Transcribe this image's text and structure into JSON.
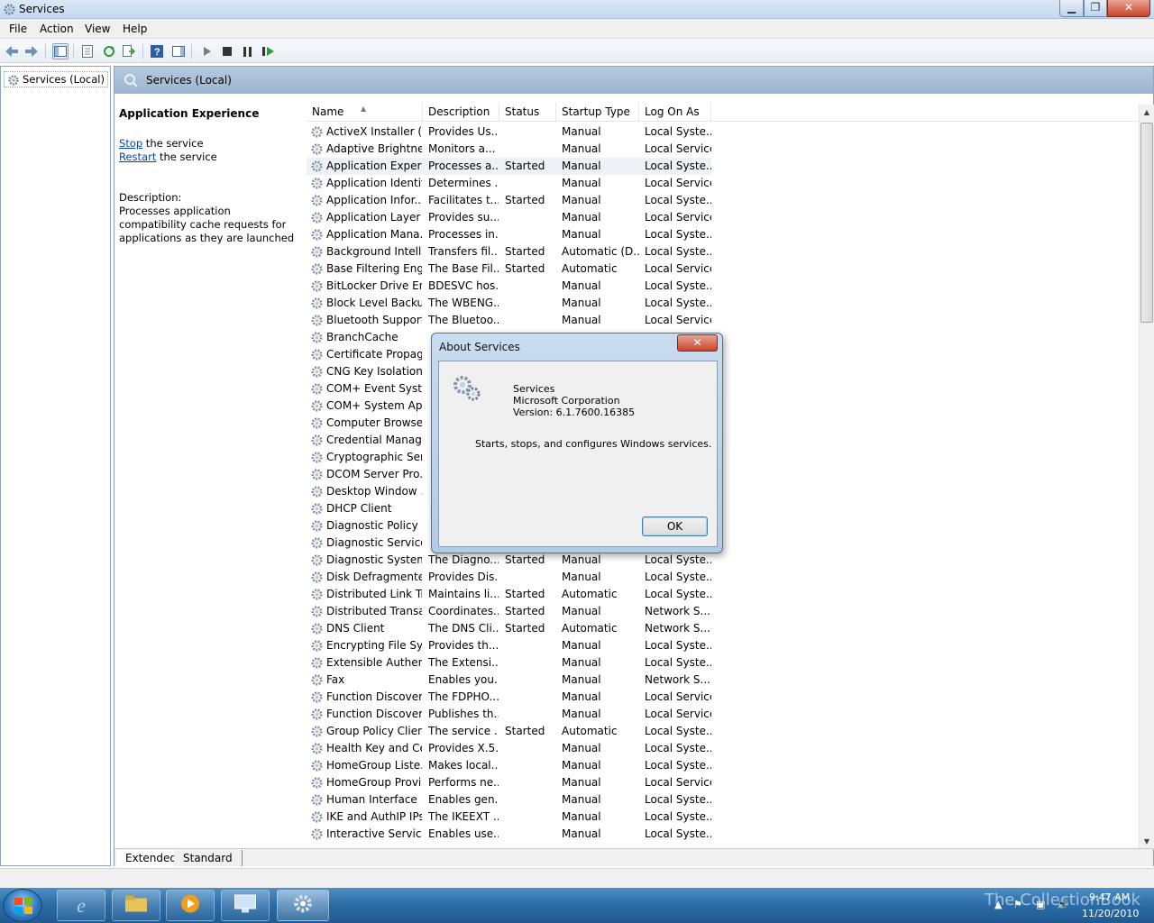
{
  "window": {
    "title": "Services",
    "minimize": "▁",
    "maximize": "❐",
    "close": "✕"
  },
  "menu": [
    "File",
    "Action",
    "View",
    "Help"
  ],
  "tree": {
    "item": "Services (Local)"
  },
  "panel": {
    "header": "Services (Local)",
    "selected_name": "Application Experience",
    "stop_link": "Stop",
    "stop_suffix": " the service",
    "restart_link": "Restart",
    "restart_suffix": " the service",
    "description_label": "Description:",
    "description": "Processes application compatibility cache requests for applications as they are launched"
  },
  "columns": [
    "Name",
    "Description",
    "Status",
    "Startup Type",
    "Log On As"
  ],
  "services": [
    {
      "name": "ActiveX Installer (...",
      "desc": "Provides Us...",
      "status": "",
      "startup": "Manual",
      "logon": "Local Syste..."
    },
    {
      "name": "Adaptive Brightness",
      "desc": "Monitors a...",
      "status": "",
      "startup": "Manual",
      "logon": "Local Service"
    },
    {
      "name": "Application Experi...",
      "desc": "Processes a...",
      "status": "Started",
      "startup": "Manual",
      "logon": "Local Syste..."
    },
    {
      "name": "Application Identity",
      "desc": "Determines ...",
      "status": "",
      "startup": "Manual",
      "logon": "Local Service"
    },
    {
      "name": "Application Infor...",
      "desc": "Facilitates t...",
      "status": "Started",
      "startup": "Manual",
      "logon": "Local Syste..."
    },
    {
      "name": "Application Layer ...",
      "desc": "Provides su...",
      "status": "",
      "startup": "Manual",
      "logon": "Local Service"
    },
    {
      "name": "Application Mana...",
      "desc": "Processes in...",
      "status": "",
      "startup": "Manual",
      "logon": "Local Syste..."
    },
    {
      "name": "Background Intelli...",
      "desc": "Transfers fil...",
      "status": "Started",
      "startup": "Automatic (D...",
      "logon": "Local Syste..."
    },
    {
      "name": "Base Filtering Engi...",
      "desc": "The Base Fil...",
      "status": "Started",
      "startup": "Automatic",
      "logon": "Local Service"
    },
    {
      "name": "BitLocker Drive En...",
      "desc": "BDESVC hos...",
      "status": "",
      "startup": "Manual",
      "logon": "Local Syste..."
    },
    {
      "name": "Block Level Backu...",
      "desc": "The WBENG...",
      "status": "",
      "startup": "Manual",
      "logon": "Local Syste..."
    },
    {
      "name": "Bluetooth Support...",
      "desc": "The Bluetoo...",
      "status": "",
      "startup": "Manual",
      "logon": "Local Service"
    },
    {
      "name": "BranchCache",
      "desc": "",
      "status": "",
      "startup": "",
      "logon": ""
    },
    {
      "name": "Certificate Propag...",
      "desc": "",
      "status": "",
      "startup": "",
      "logon": ""
    },
    {
      "name": "CNG Key Isolation",
      "desc": "",
      "status": "",
      "startup": "",
      "logon": ""
    },
    {
      "name": "COM+ Event Syst...",
      "desc": "",
      "status": "",
      "startup": "",
      "logon": ""
    },
    {
      "name": "COM+ System Ap...",
      "desc": "",
      "status": "",
      "startup": "",
      "logon": ""
    },
    {
      "name": "Computer Browser",
      "desc": "",
      "status": "",
      "startup": "",
      "logon": ""
    },
    {
      "name": "Credential Manager",
      "desc": "",
      "status": "",
      "startup": "",
      "logon": ""
    },
    {
      "name": "Cryptographic Ser...",
      "desc": "",
      "status": "",
      "startup": "",
      "logon": ""
    },
    {
      "name": "DCOM Server Pro...",
      "desc": "",
      "status": "",
      "startup": "",
      "logon": ""
    },
    {
      "name": "Desktop Window ...",
      "desc": "",
      "status": "",
      "startup": "",
      "logon": ""
    },
    {
      "name": "DHCP Client",
      "desc": "",
      "status": "",
      "startup": "",
      "logon": ""
    },
    {
      "name": "Diagnostic Policy ...",
      "desc": "",
      "status": "",
      "startup": "",
      "logon": ""
    },
    {
      "name": "Diagnostic Service...",
      "desc": "",
      "status": "",
      "startup": "",
      "logon": ""
    },
    {
      "name": "Diagnostic System...",
      "desc": "The Diagno...",
      "status": "Started",
      "startup": "Manual",
      "logon": "Local Syste..."
    },
    {
      "name": "Disk Defragmenter",
      "desc": "Provides Dis...",
      "status": "",
      "startup": "Manual",
      "logon": "Local Syste..."
    },
    {
      "name": "Distributed Link Tr...",
      "desc": "Maintains li...",
      "status": "Started",
      "startup": "Automatic",
      "logon": "Local Syste..."
    },
    {
      "name": "Distributed Transa...",
      "desc": "Coordinates...",
      "status": "Started",
      "startup": "Manual",
      "logon": "Network S..."
    },
    {
      "name": "DNS Client",
      "desc": "The DNS Cli...",
      "status": "Started",
      "startup": "Automatic",
      "logon": "Network S..."
    },
    {
      "name": "Encrypting File Sy...",
      "desc": "Provides th...",
      "status": "",
      "startup": "Manual",
      "logon": "Local Syste..."
    },
    {
      "name": "Extensible Authen...",
      "desc": "The Extensi...",
      "status": "",
      "startup": "Manual",
      "logon": "Local Syste..."
    },
    {
      "name": "Fax",
      "desc": "Enables you...",
      "status": "",
      "startup": "Manual",
      "logon": "Network S..."
    },
    {
      "name": "Function Discover...",
      "desc": "The FDPHO...",
      "status": "",
      "startup": "Manual",
      "logon": "Local Service"
    },
    {
      "name": "Function Discover...",
      "desc": "Publishes th...",
      "status": "",
      "startup": "Manual",
      "logon": "Local Service"
    },
    {
      "name": "Group Policy Client",
      "desc": "The service ...",
      "status": "Started",
      "startup": "Automatic",
      "logon": "Local Syste..."
    },
    {
      "name": "Health Key and Ce...",
      "desc": "Provides X.5...",
      "status": "",
      "startup": "Manual",
      "logon": "Local Syste..."
    },
    {
      "name": "HomeGroup Liste...",
      "desc": "Makes local...",
      "status": "",
      "startup": "Manual",
      "logon": "Local Syste..."
    },
    {
      "name": "HomeGroup Provi...",
      "desc": "Performs ne...",
      "status": "",
      "startup": "Manual",
      "logon": "Local Service"
    },
    {
      "name": "Human Interface ...",
      "desc": "Enables gen...",
      "status": "",
      "startup": "Manual",
      "logon": "Local Syste..."
    },
    {
      "name": "IKE and AuthIP IPs...",
      "desc": "The IKEEXT ...",
      "status": "",
      "startup": "Manual",
      "logon": "Local Syste..."
    },
    {
      "name": "Interactive Service...",
      "desc": "Enables use...",
      "status": "",
      "startup": "Manual",
      "logon": "Local Syste..."
    }
  ],
  "selected_row": 2,
  "tabs": [
    "Extended",
    "Standard"
  ],
  "dialog": {
    "title": "About Services",
    "close": "✕",
    "app_name": "Services",
    "company": "Microsoft Corporation",
    "version": "Version: 6.1.7600.16385",
    "message": "Starts, stops, and configures Windows services.",
    "ok": "OK"
  },
  "taskbar": {
    "watermark": "The CollectionBook",
    "time": "9:47 AM",
    "date": "11/20/2010"
  },
  "colors": {
    "accent": "#2c6ea8",
    "header": "#9cb4cf",
    "link": "#0645ad"
  }
}
